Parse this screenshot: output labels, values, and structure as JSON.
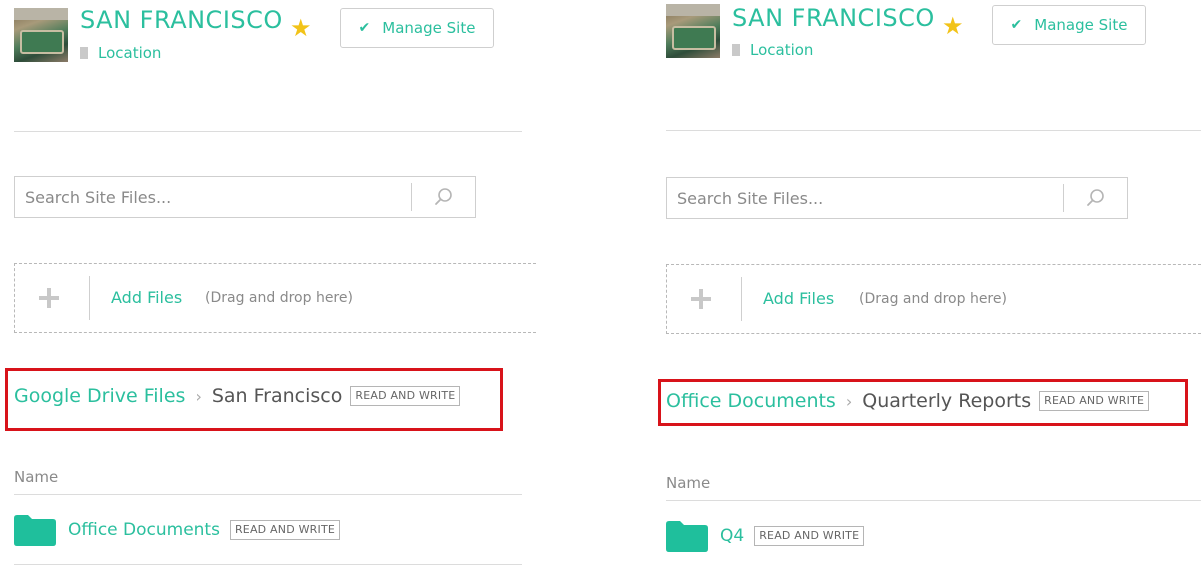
{
  "panels": [
    {
      "site_title": "SAN FRANCISCO",
      "location_label": "Location",
      "manage_button": "Manage Site",
      "search_placeholder": "Search Site Files...",
      "add_files": "Add Files",
      "drag_hint": "(Drag and drop here)",
      "breadcrumb": {
        "parent": "Google Drive Files",
        "current": "San Francisco",
        "badge": "READ AND WRITE"
      },
      "column_header": "Name",
      "rows": [
        {
          "name": "Office Documents",
          "badge": "READ AND WRITE"
        }
      ]
    },
    {
      "site_title": "SAN FRANCISCO",
      "location_label": "Location",
      "manage_button": "Manage Site",
      "search_placeholder": "Search Site Files...",
      "add_files": "Add Files",
      "drag_hint": "(Drag and drop here)",
      "breadcrumb": {
        "parent": "Office Documents",
        "current": "Quarterly Reports",
        "badge": "READ AND WRITE"
      },
      "column_header": "Name",
      "rows": [
        {
          "name": "Q4",
          "badge": "READ AND WRITE"
        }
      ]
    }
  ],
  "colors": {
    "accent": "#2bbf9e",
    "star": "#f2c318",
    "highlight": "#d8131a",
    "folder": "#1fbf9c"
  },
  "icons": [
    "site-thumbnail",
    "star-icon",
    "building-icon",
    "check-icon",
    "search-icon",
    "plus-icon",
    "chevron-right-icon",
    "folder-icon"
  ]
}
